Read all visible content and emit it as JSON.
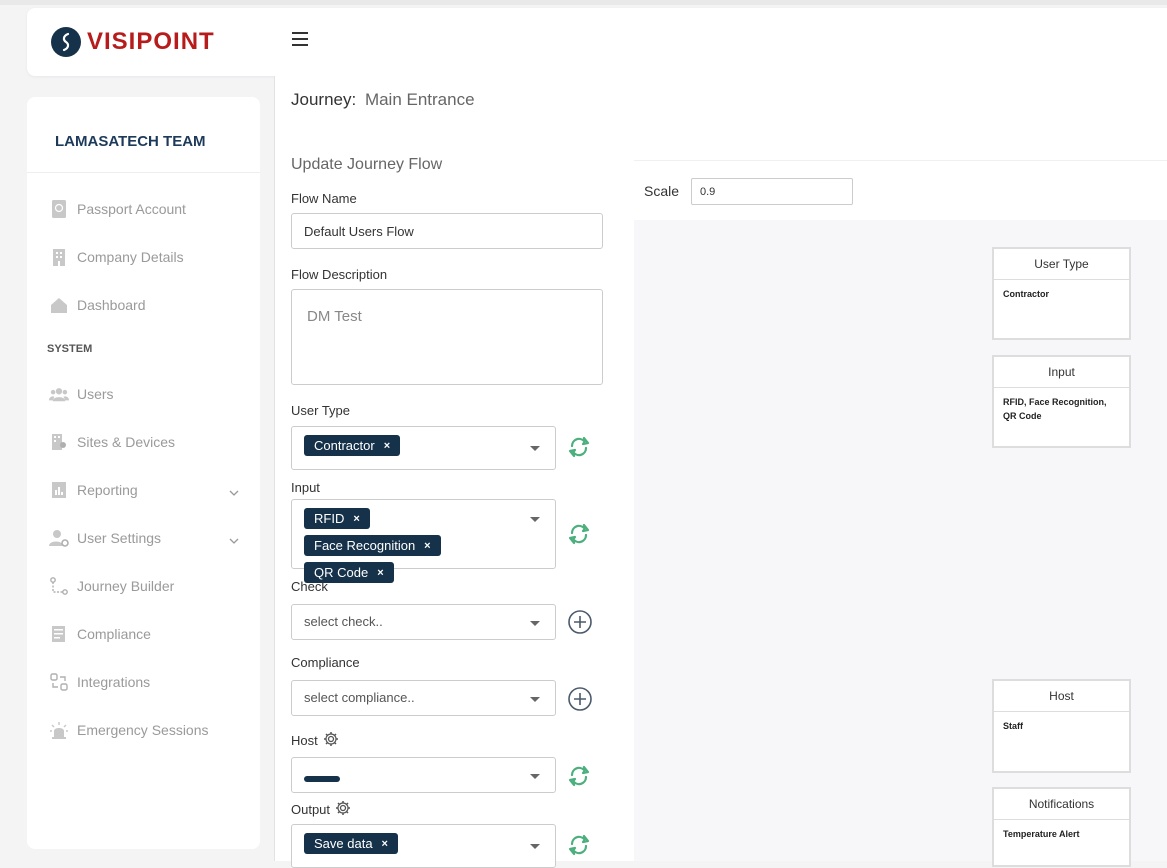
{
  "header": {
    "logo_text": "VISIPOINT"
  },
  "sidebar": {
    "team": "LAMASATECH TEAM",
    "section_system": "SYSTEM",
    "items": [
      {
        "label": "Passport Account"
      },
      {
        "label": "Company Details"
      },
      {
        "label": "Dashboard"
      },
      {
        "label": "Users"
      },
      {
        "label": "Sites & Devices"
      },
      {
        "label": "Reporting"
      },
      {
        "label": "User Settings"
      },
      {
        "label": "Journey Builder"
      },
      {
        "label": "Compliance"
      },
      {
        "label": "Integrations"
      },
      {
        "label": "Emergency Sessions"
      }
    ]
  },
  "journey": {
    "label": "Journey:",
    "name": "Main Entrance"
  },
  "form": {
    "section_title": "Update Journey Flow",
    "flow_name_label": "Flow Name",
    "flow_name_value": "Default Users Flow",
    "flow_description_label": "Flow Description",
    "flow_description_value": "DM Test",
    "user_type_label": "User Type",
    "user_type_chips": [
      "Contractor"
    ],
    "input_label": "Input",
    "input_chips": [
      "RFID",
      "Face Recognition",
      "QR Code"
    ],
    "check_label": "Check",
    "check_placeholder": "select check..",
    "compliance_label": "Compliance",
    "compliance_placeholder": "select compliance..",
    "host_label": "Host",
    "output_label": "Output",
    "output_chips": [
      "Save data"
    ],
    "chip_remove": "×"
  },
  "canvas": {
    "scale_label": "Scale",
    "scale_value": "0.9",
    "nodes": [
      {
        "title": "User Type",
        "body": "Contractor"
      },
      {
        "title": "Input",
        "body": "RFID, Face Recognition, QR Code"
      },
      {
        "title": "Host",
        "body": "Staff"
      },
      {
        "title": "Notifications",
        "body": "Temperature Alert"
      }
    ]
  },
  "colors": {
    "brand_navy": "#16324a",
    "brand_red": "#b71c1c",
    "sync_green": "#4caf7d"
  }
}
